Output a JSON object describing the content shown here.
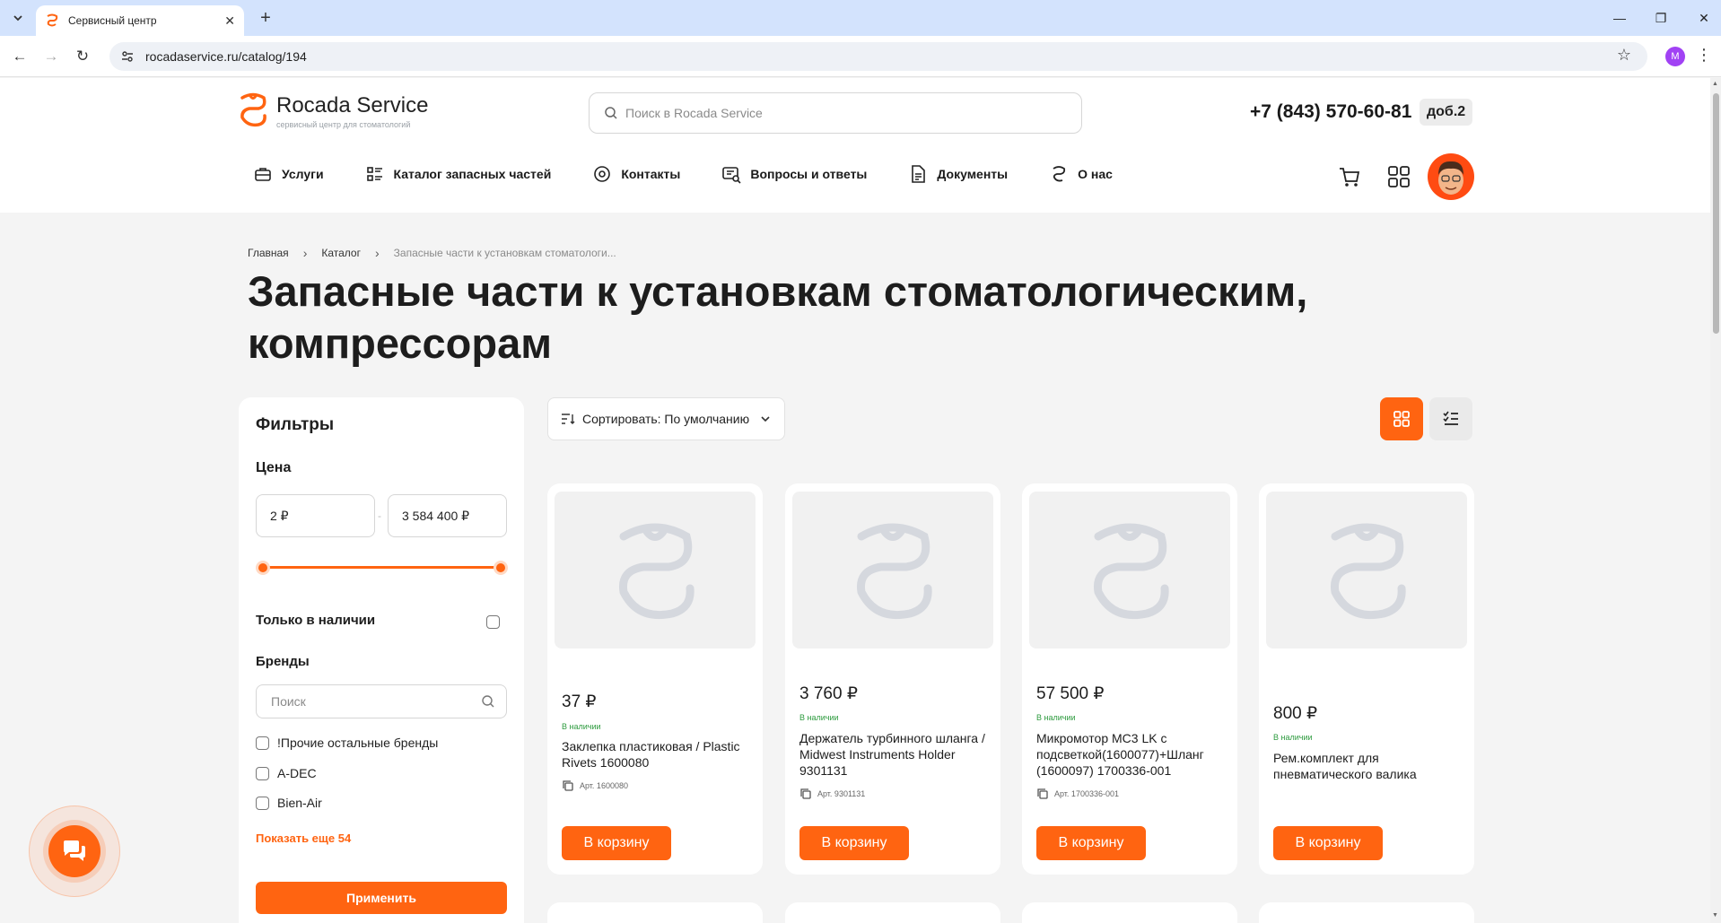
{
  "browser": {
    "tab_title": "Сервисный центр",
    "url": "rocadaservice.ru/catalog/194",
    "profile_initial": "M"
  },
  "header": {
    "logo_name": "Rocada Service",
    "logo_sub": "сервисный центр для стоматологий",
    "search_placeholder": "Поиск в Rocada Service",
    "phone": "+7 (843) 570-60-81",
    "ext": "доб.2",
    "menu": [
      {
        "label": "Услуги",
        "icon": "briefcase-icon"
      },
      {
        "label": "Каталог запасных частей",
        "icon": "catalog-list-icon"
      },
      {
        "label": "Контакты",
        "icon": "location-pin-icon"
      },
      {
        "label": "Вопросы и ответы",
        "icon": "faq-icon"
      },
      {
        "label": "Документы",
        "icon": "document-icon"
      },
      {
        "label": "О нас",
        "icon": "tooth-icon"
      }
    ]
  },
  "breadcrumb": [
    "Главная",
    "Каталог",
    "Запасные части к установкам стоматологи..."
  ],
  "page_title": "Запасные части к установкам стоматологическим, компрессорам",
  "filters": {
    "title": "Фильтры",
    "price_label": "Цена",
    "price_min": "2 ₽",
    "price_max": "3 584 400 ₽",
    "in_stock_label": "Только в наличии",
    "brands_label": "Бренды",
    "brand_search_placeholder": "Поиск",
    "brands": [
      "!Прочие остальные бренды",
      "A-DEC",
      "Bien-Air"
    ],
    "show_more": "Показать еще 54",
    "apply": "Применить"
  },
  "toolbar": {
    "sort_label": "Сортировать: По умолчанию"
  },
  "products": [
    {
      "price": "37 ₽",
      "stock": "В наличии",
      "name": "Заклепка пластиковая / Plastic Rivets 1600080",
      "sku": "Арт. 1600080",
      "button": "В корзину"
    },
    {
      "price": "3 760 ₽",
      "stock": "В наличии",
      "name": "Держатель турбинного шланга / Midwest Instruments Holder 9301131",
      "sku": "Арт. 9301131",
      "button": "В корзину"
    },
    {
      "price": "57 500 ₽",
      "stock": "В наличии",
      "name": "Микромотор МС3 LK с подсветкой(1600077)+Шланг (1600097) 1700336-001",
      "sku": "Арт. 1700336-001",
      "button": "В корзину"
    },
    {
      "price": "800 ₽",
      "stock": "В наличии",
      "name": "Рем.комплект для пневматического валика",
      "sku": "",
      "button": "В корзину"
    }
  ],
  "colors": {
    "accent": "#ff6411",
    "in_stock": "#2e9b3f",
    "page_bg": "#f4f4f4"
  }
}
